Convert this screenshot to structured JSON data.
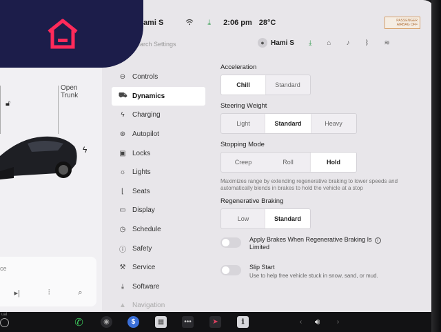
{
  "status_bar": {
    "profile_name": "Hami S",
    "time": "2:06 pm",
    "temperature": "28°C",
    "airbag_label": "PASSENGER AIRBAG OFF"
  },
  "header": {
    "search_placeholder": "Search Settings",
    "profile_name": "Hami S"
  },
  "car_panel": {
    "open_trunk_line1": "Open",
    "open_trunk_line2": "Trunk",
    "bottom_card_partial_text": "ce"
  },
  "nav": {
    "items": [
      {
        "label": "Controls",
        "icon": "toggle-icon"
      },
      {
        "label": "Dynamics",
        "icon": "car-icon",
        "active": true
      },
      {
        "label": "Charging",
        "icon": "bolt-icon"
      },
      {
        "label": "Autopilot",
        "icon": "steering-wheel-icon"
      },
      {
        "label": "Locks",
        "icon": "lock-icon"
      },
      {
        "label": "Lights",
        "icon": "sun-icon"
      },
      {
        "label": "Seats",
        "icon": "seat-icon"
      },
      {
        "label": "Display",
        "icon": "display-icon"
      },
      {
        "label": "Schedule",
        "icon": "clock-icon"
      },
      {
        "label": "Safety",
        "icon": "info-circle-icon"
      },
      {
        "label": "Service",
        "icon": "wrench-icon"
      },
      {
        "label": "Software",
        "icon": "download-icon"
      },
      {
        "label": "Navigation",
        "icon": "navigation-icon"
      }
    ]
  },
  "settings": {
    "acceleration": {
      "title": "Acceleration",
      "options": [
        "Chill",
        "Standard"
      ],
      "selected": "Chill"
    },
    "steering_weight": {
      "title": "Steering Weight",
      "options": [
        "Light",
        "Standard",
        "Heavy"
      ],
      "selected": "Standard"
    },
    "stopping_mode": {
      "title": "Stopping Mode",
      "options": [
        "Creep",
        "Roll",
        "Hold"
      ],
      "selected": "Hold",
      "description": "Maximizes range by extending regenerative braking to lower speeds and automatically blends in brakes to hold the vehicle at a stop"
    },
    "regenerative_braking": {
      "title": "Regenerative Braking",
      "options": [
        "Low",
        "Standard"
      ],
      "selected": "Standard"
    },
    "apply_brakes": {
      "label_line1": "Apply Brakes When Regenerative Braking Is",
      "label_line2": "Limited",
      "enabled": false
    },
    "slip_start": {
      "label": "Slip Start",
      "description": "Use to help free vehicle stuck in snow, sand, or mud.",
      "enabled": false
    }
  },
  "taskbar": {
    "partial_label": "ual"
  },
  "colors": {
    "logo_bg": "#1c1d4a",
    "logo_icon": "#ff2a5a",
    "download_green": "#2e9a4a"
  }
}
